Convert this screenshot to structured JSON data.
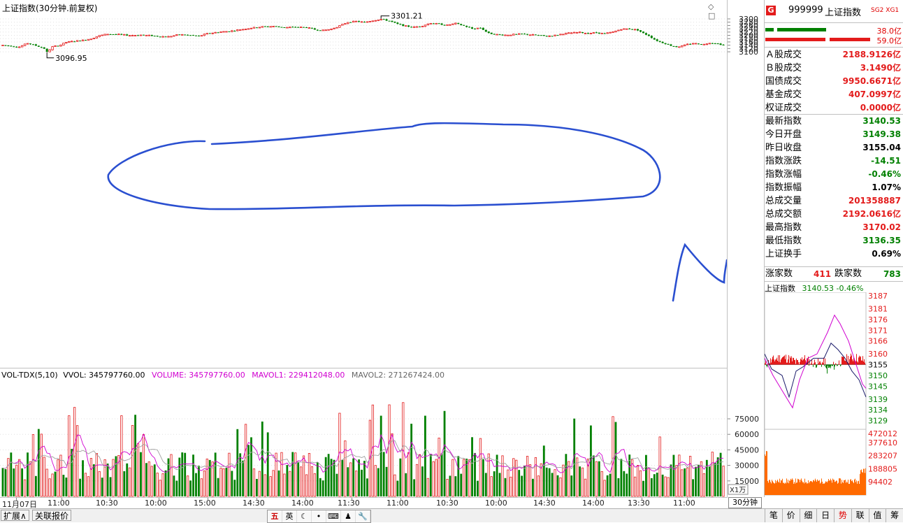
{
  "chart": {
    "title": "上证指数(30分钟.前复权)",
    "high_label": "3301.21",
    "low_label": "3096.95",
    "price_axis": [
      "3300",
      "3280",
      "3260",
      "3240",
      "3220",
      "3200",
      "3180",
      "3160",
      "3140",
      "3120",
      "3100"
    ],
    "controls": "◇ □"
  },
  "volume": {
    "indicator": "VOL-TDX(5,10)",
    "vvol": "VVOL: 345797760.00",
    "volume": "VOLUME: 345797760.00",
    "mavol1": "MAVOL1: 229412048.00",
    "mavol2": "MAVOL2: 271267424.00",
    "axis": [
      "75000",
      "60000",
      "45000",
      "30000",
      "15000"
    ],
    "unit": "X1万"
  },
  "time_axis": [
    "11月07日",
    "11:00",
    "10:30",
    "10:00",
    "15:00",
    "14:30",
    "14:00",
    "11:30",
    "11:00",
    "10:30",
    "10:00",
    "14:30",
    "14:00",
    "13:30",
    "11:00"
  ],
  "period": "30分钟",
  "right_panel": {
    "badge": "G",
    "code": "999999",
    "name": "上证指数",
    "tags": "SG2 XG1",
    "bar1_value": "38.0亿",
    "bar2_value": "59.0亿",
    "stats": [
      {
        "label": "Ａ股成交",
        "value": "2188.9126亿"
      },
      {
        "label": "Ｂ股成交",
        "value": "3.1490亿"
      },
      {
        "label": "国债成交",
        "value": "9950.6671亿"
      },
      {
        "label": "基金成交",
        "value": "407.0997亿"
      },
      {
        "label": "权证成交",
        "value": "0.0000亿"
      },
      {
        "label": "最新指数",
        "value": "3140.53"
      },
      {
        "label": "今日开盘",
        "value": "3149.38"
      },
      {
        "label": "昨日收盘",
        "value": "3155.04"
      },
      {
        "label": "指数涨跌",
        "value": "-14.51"
      },
      {
        "label": "指数涨幅",
        "value": "-0.46%"
      },
      {
        "label": "指数振幅",
        "value": "1.07%"
      },
      {
        "label": "总成交量",
        "value": "201358887"
      },
      {
        "label": "总成交额",
        "value": "2192.0616亿"
      },
      {
        "label": "最高指数",
        "value": "3170.02"
      },
      {
        "label": "最低指数",
        "value": "3136.35"
      },
      {
        "label": "上证换手",
        "value": "0.69%"
      }
    ],
    "up_label": "涨家数",
    "up_value": "411",
    "down_label": "跌家数",
    "down_value": "783",
    "mini_title": "上证指数",
    "mini_value": "3140.53 -0.46%",
    "mini_axis": [
      "3187",
      "3181",
      "3176",
      "3171",
      "3166",
      "3160",
      "3155",
      "3150",
      "3145",
      "3139",
      "3134",
      "3129"
    ],
    "mini_vol_axis": [
      "472012",
      "377610",
      "283207",
      "188805",
      "94402"
    ]
  },
  "bottom": {
    "tab1": "扩展∧",
    "tab2": "关联报价",
    "ime": [
      "五",
      "英",
      "☾",
      "•",
      "⌨",
      "♟",
      "🔧"
    ],
    "right_tabs": [
      "笔",
      "价",
      "细",
      "日",
      "势",
      "联",
      "值",
      "筹"
    ],
    "active_tab": "势"
  },
  "colors": {
    "up": "#e31b1b",
    "down": "#008000",
    "annotation": "#2a4fd0",
    "mavol1": "#d000d0",
    "mavol2": "#222222"
  }
}
